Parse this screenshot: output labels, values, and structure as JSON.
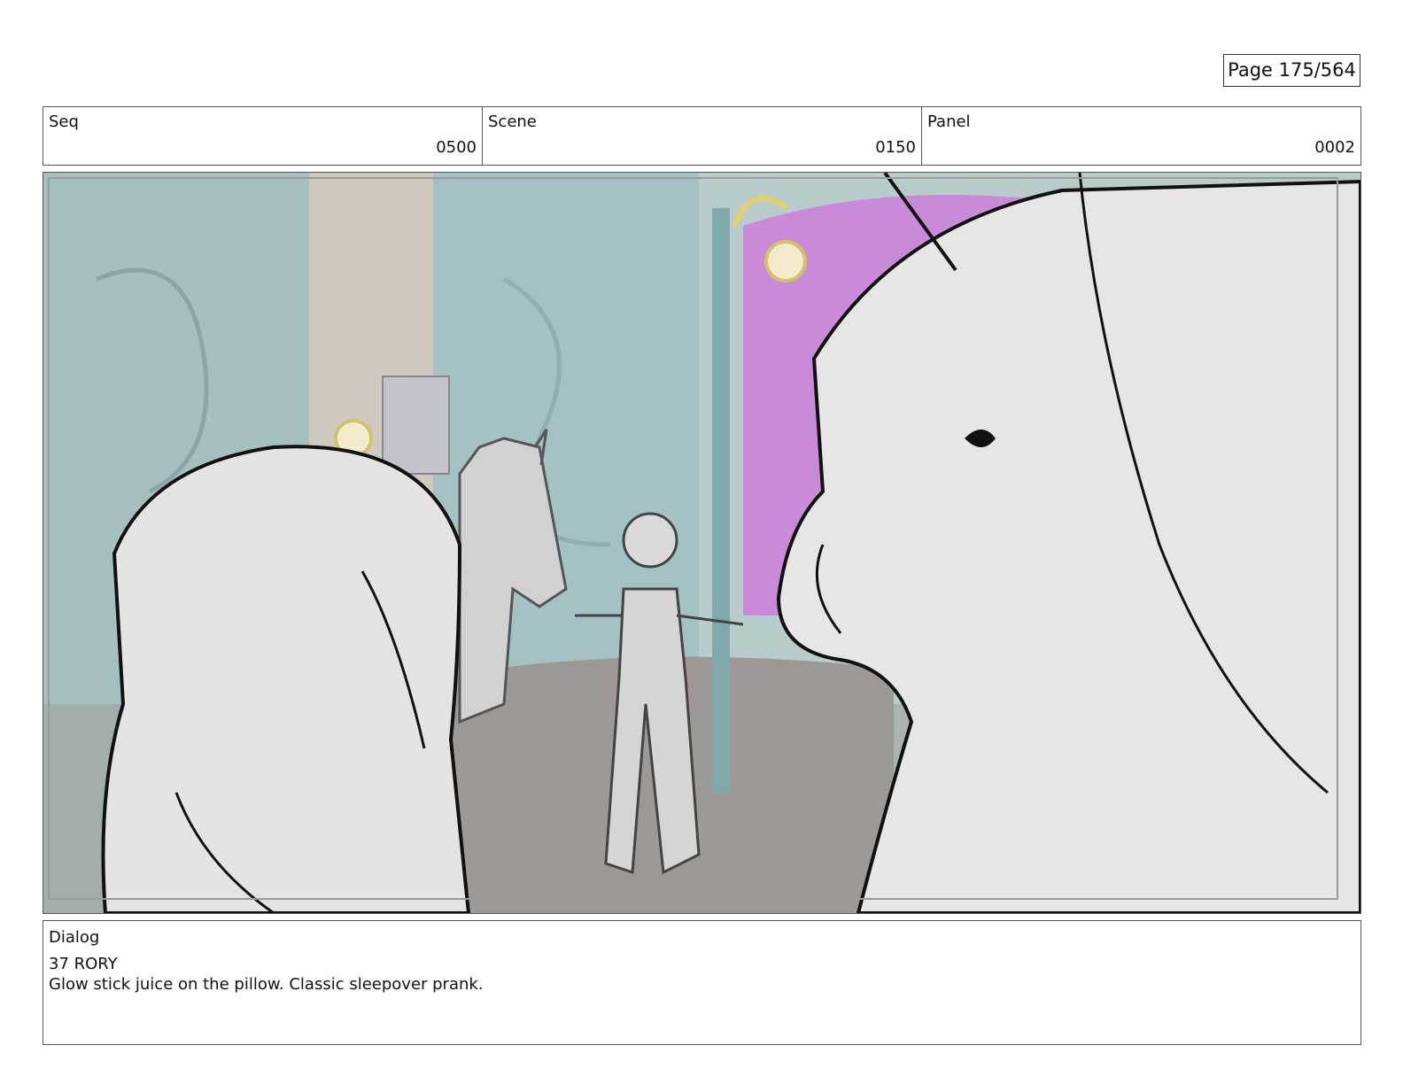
{
  "page": {
    "number_label": "Page 175/564"
  },
  "header": {
    "seq": {
      "label": "Seq",
      "value": "0500"
    },
    "scene": {
      "label": "Scene",
      "value": "0150"
    },
    "panel": {
      "label": "Panel",
      "value": "0002"
    }
  },
  "colors": {
    "wall": "#a9c4c4",
    "magenta_panel": "#c98ad8",
    "floor": "#9e9a98",
    "sketch_fill": "#e4e4e4",
    "lamp": "#e8d77a",
    "ink": "#111111"
  },
  "dialog": {
    "label": "Dialog",
    "character_line": "37 RORY",
    "text": "Glow stick juice on the pillow. Classic sleepover prank."
  }
}
